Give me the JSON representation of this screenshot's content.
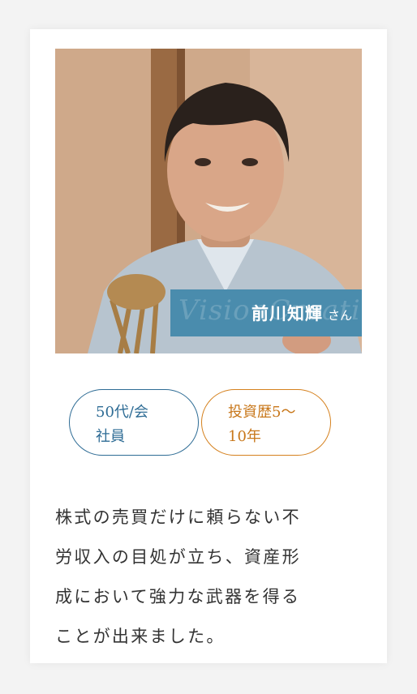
{
  "profile": {
    "name": "前川知輝",
    "honorific": "さん",
    "watermark": "VisionCreation"
  },
  "tags": {
    "age_line1": "50代/会",
    "age_line2": "社員",
    "experience_line1": "投資歴5〜",
    "experience_line2": "10年"
  },
  "quote": {
    "line1": "株式の売買だけに頼らない不",
    "line2": "労収入の目処が立ち、資産形",
    "line3": "成において強力な武器を得る",
    "line4": "ことが出来ました。"
  },
  "colors": {
    "name_plate": "#4a8cad",
    "tag_age": "#2e6c95",
    "tag_experience": "#d5811e",
    "text": "#333333"
  }
}
